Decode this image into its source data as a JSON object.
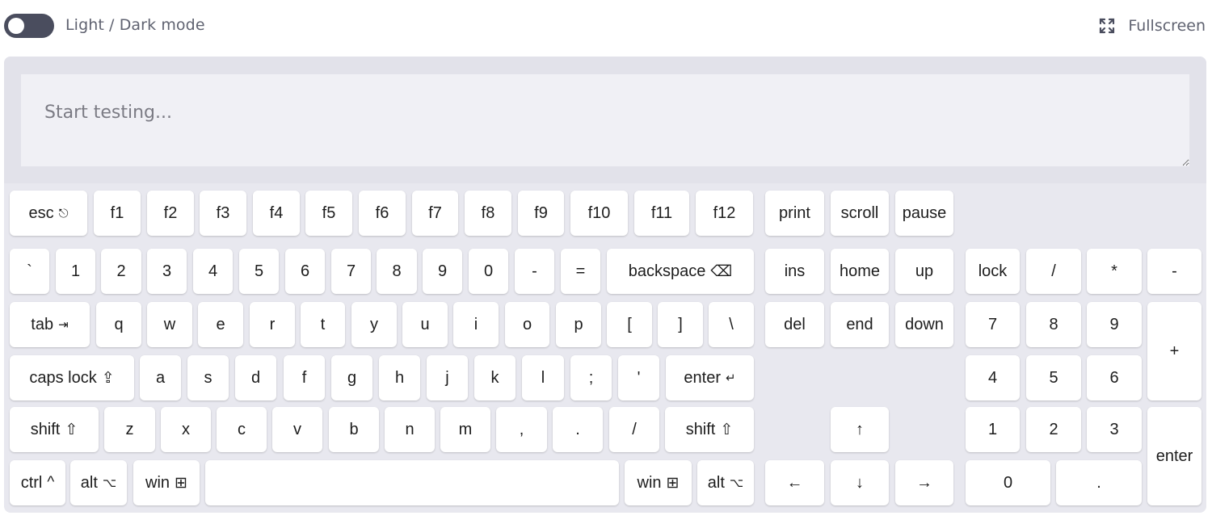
{
  "header": {
    "theme_toggle_label": "Light / Dark mode",
    "theme_toggle_state": "off",
    "fullscreen_label": "Fullscreen"
  },
  "input": {
    "placeholder": "Start testing...",
    "value": ""
  },
  "keyboard": {
    "function_row": [
      {
        "label": "esc",
        "symbol": "⎋"
      },
      {
        "label": "f1"
      },
      {
        "label": "f2"
      },
      {
        "label": "f3"
      },
      {
        "label": "f4"
      },
      {
        "label": "f5"
      },
      {
        "label": "f6"
      },
      {
        "label": "f7"
      },
      {
        "label": "f8"
      },
      {
        "label": "f9"
      },
      {
        "label": "f10"
      },
      {
        "label": "f11"
      },
      {
        "label": "f12"
      }
    ],
    "system_row": [
      {
        "label": "print"
      },
      {
        "label": "scroll"
      },
      {
        "label": "pause"
      }
    ],
    "number_row": [
      {
        "label": "`"
      },
      {
        "label": "1"
      },
      {
        "label": "2"
      },
      {
        "label": "3"
      },
      {
        "label": "4"
      },
      {
        "label": "5"
      },
      {
        "label": "6"
      },
      {
        "label": "7"
      },
      {
        "label": "8"
      },
      {
        "label": "9"
      },
      {
        "label": "0"
      },
      {
        "label": "-"
      },
      {
        "label": "="
      },
      {
        "label": "backspace",
        "symbol": "⌫"
      }
    ],
    "top_letter_row": [
      {
        "label": "tab",
        "symbol": "⇥"
      },
      {
        "label": "q"
      },
      {
        "label": "w"
      },
      {
        "label": "e"
      },
      {
        "label": "r"
      },
      {
        "label": "t"
      },
      {
        "label": "y"
      },
      {
        "label": "u"
      },
      {
        "label": "i"
      },
      {
        "label": "o"
      },
      {
        "label": "p"
      },
      {
        "label": "["
      },
      {
        "label": "]"
      },
      {
        "label": "\\"
      }
    ],
    "home_row": [
      {
        "label": "caps lock",
        "symbol": "⇪"
      },
      {
        "label": "a"
      },
      {
        "label": "s"
      },
      {
        "label": "d"
      },
      {
        "label": "f"
      },
      {
        "label": "g"
      },
      {
        "label": "h"
      },
      {
        "label": "j"
      },
      {
        "label": "k"
      },
      {
        "label": "l"
      },
      {
        "label": ";"
      },
      {
        "label": "'"
      },
      {
        "label": "enter",
        "symbol": "↵"
      }
    ],
    "bottom_letter_row": [
      {
        "label": "shift",
        "symbol": "⇧"
      },
      {
        "label": "z"
      },
      {
        "label": "x"
      },
      {
        "label": "c"
      },
      {
        "label": "v"
      },
      {
        "label": "b"
      },
      {
        "label": "n"
      },
      {
        "label": "m"
      },
      {
        "label": ","
      },
      {
        "label": "."
      },
      {
        "label": "/"
      },
      {
        "label": "shift",
        "symbol": "⇧"
      }
    ],
    "space_row": [
      {
        "label": "ctrl",
        "symbol": "^"
      },
      {
        "label": "alt",
        "symbol": "⌥"
      },
      {
        "label": "win",
        "symbol": "⊞"
      },
      {
        "label": ""
      },
      {
        "label": "win",
        "symbol": "⊞"
      },
      {
        "label": "alt",
        "symbol": "⌥"
      }
    ],
    "navigation": [
      {
        "label": "ins"
      },
      {
        "label": "home"
      },
      {
        "label": "up"
      },
      {
        "label": "del"
      },
      {
        "label": "end"
      },
      {
        "label": "down"
      }
    ],
    "arrows": [
      {
        "label": "↑"
      },
      {
        "label": "←"
      },
      {
        "label": "↓"
      },
      {
        "label": "→"
      }
    ],
    "numpad": [
      {
        "label": "lock"
      },
      {
        "label": "/"
      },
      {
        "label": "*"
      },
      {
        "label": "-"
      },
      {
        "label": "7"
      },
      {
        "label": "8"
      },
      {
        "label": "9"
      },
      {
        "label": "+"
      },
      {
        "label": "4"
      },
      {
        "label": "5"
      },
      {
        "label": "6"
      },
      {
        "label": "1"
      },
      {
        "label": "2"
      },
      {
        "label": "3"
      },
      {
        "label": "enter"
      },
      {
        "label": "0"
      },
      {
        "label": "."
      }
    ]
  }
}
